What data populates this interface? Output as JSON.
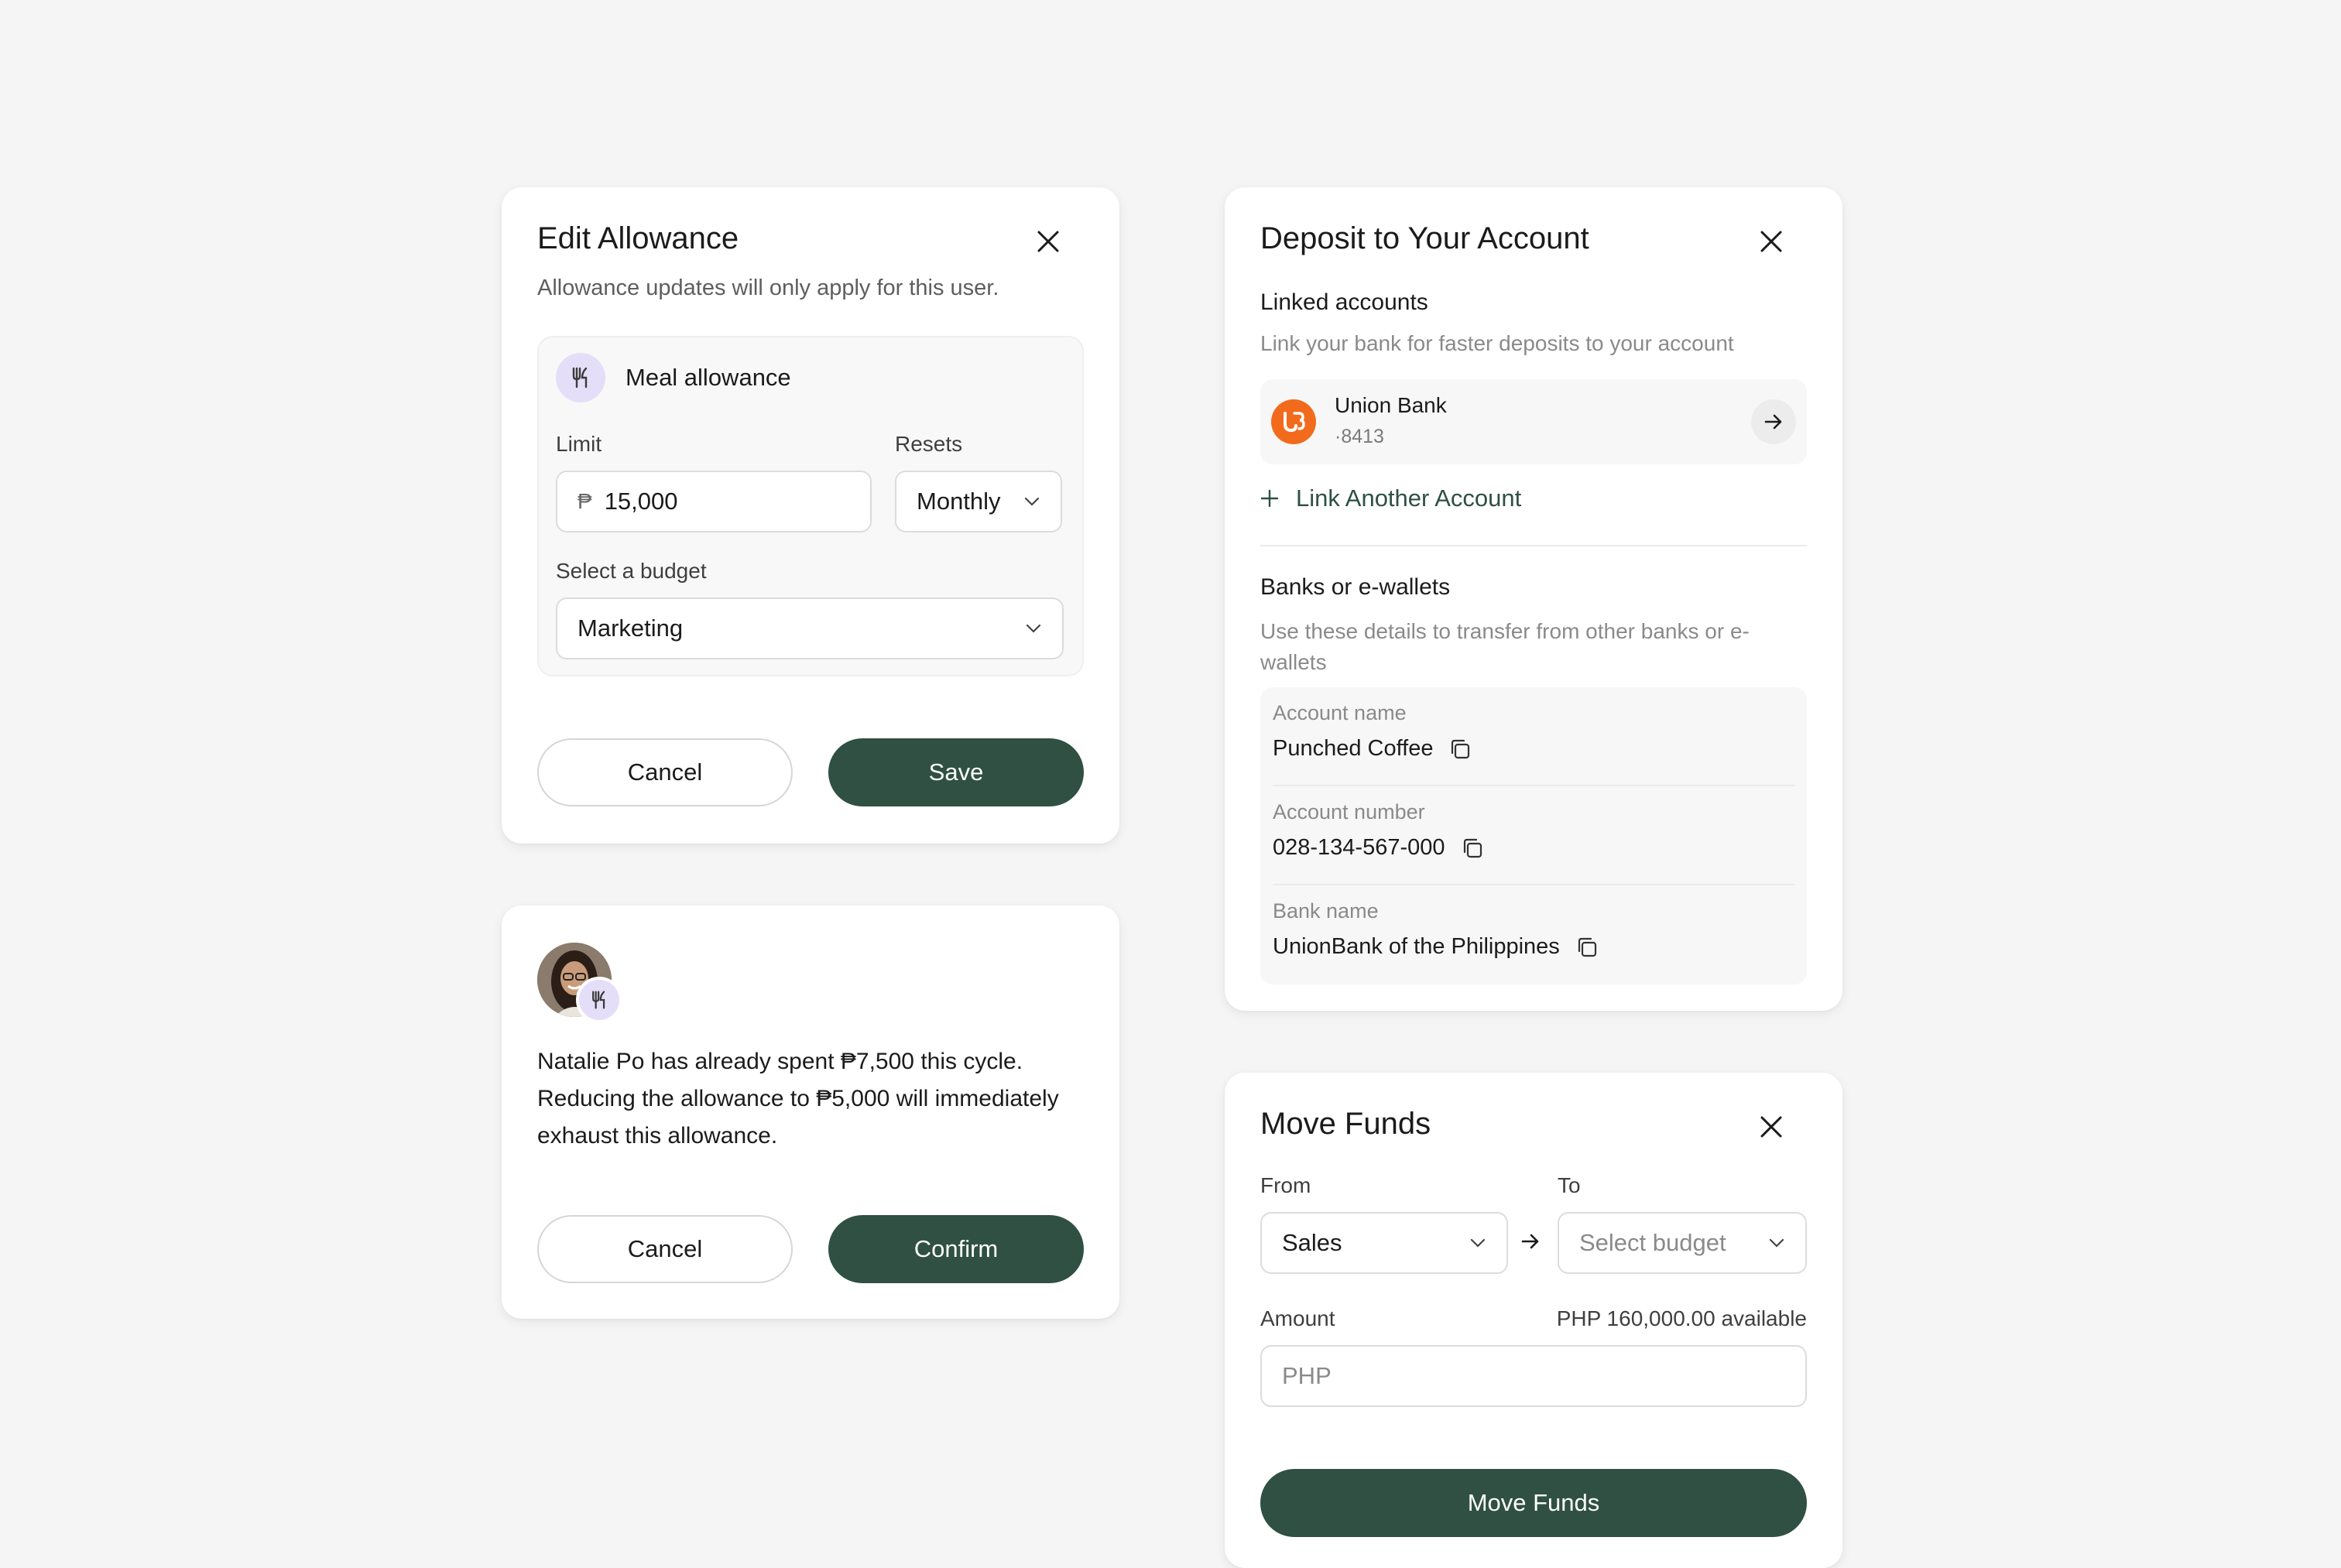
{
  "edit_allowance": {
    "title": "Edit Allowance",
    "subtitle": "Allowance updates will only apply for this user.",
    "allowance_name": "Meal allowance",
    "limit_label": "Limit",
    "currency_symbol": "₱",
    "limit_value": "15,000",
    "resets_label": "Resets",
    "resets_value": "Monthly",
    "budget_label": "Select a budget",
    "budget_value": "Marketing",
    "cancel_label": "Cancel",
    "save_label": "Save"
  },
  "confirm_dialog": {
    "message_line1": "Natalie Po has already spent ₱7,500 this cycle.",
    "message_line2": "Reducing the allowance to ₱5,000 will immediately",
    "message_line3": "exhaust this allowance.",
    "cancel_label": "Cancel",
    "confirm_label": "Confirm"
  },
  "deposit": {
    "title": "Deposit to Your Account",
    "linked_heading": "Linked accounts",
    "linked_desc": "Link your bank for faster deposits to your account",
    "bank_name": "Union Bank",
    "bank_mask": "·8413",
    "link_another": "Link Another Account",
    "banks_heading": "Banks or e-wallets",
    "banks_desc_line1": "Use these details to transfer from other banks or e-",
    "banks_desc_line2": "wallets",
    "details": [
      {
        "label": "Account name",
        "value": "Punched Coffee"
      },
      {
        "label": "Account number",
        "value": "028-134-567-000"
      },
      {
        "label": "Bank name",
        "value": "UnionBank of the Philippines"
      }
    ]
  },
  "move_funds": {
    "title": "Move Funds",
    "from_label": "From",
    "from_value": "Sales",
    "to_label": "To",
    "to_placeholder": "Select budget",
    "amount_label": "Amount",
    "available": "PHP 160,000.00 available",
    "amount_placeholder": "PHP",
    "submit_label": "Move Funds"
  },
  "colors": {
    "primary": "#2f5043",
    "icon_bg": "#e4def8",
    "bank_logo": "#f26b1d"
  }
}
